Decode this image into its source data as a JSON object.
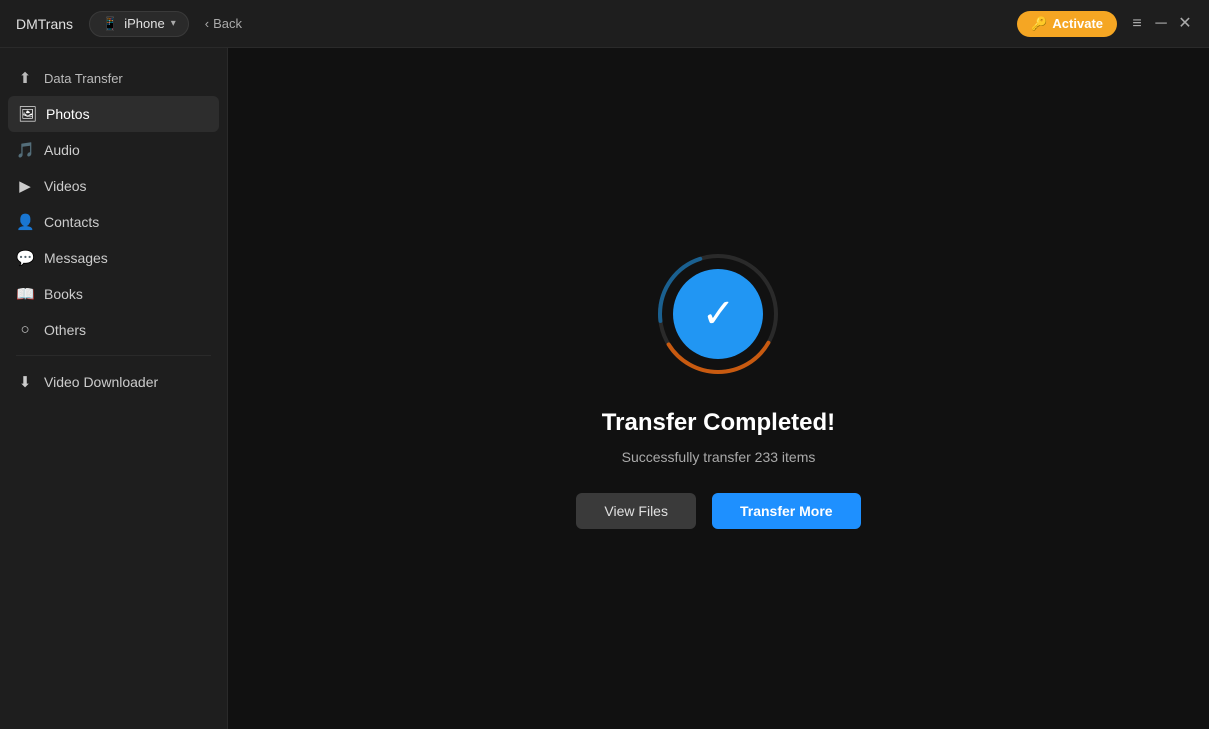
{
  "app": {
    "title": "DMTrans"
  },
  "titlebar": {
    "device_label": "iPhone",
    "back_label": "Back",
    "activate_label": "Activate",
    "menu_icon": "≡",
    "minimize_icon": "─",
    "close_icon": "✕"
  },
  "sidebar": {
    "data_transfer_label": "Data Transfer",
    "items": [
      {
        "id": "photos",
        "label": "Photos",
        "icon": "🖼"
      },
      {
        "id": "audio",
        "label": "Audio",
        "icon": "🎵"
      },
      {
        "id": "videos",
        "label": "Videos",
        "icon": "▶"
      },
      {
        "id": "contacts",
        "label": "Contacts",
        "icon": "👤"
      },
      {
        "id": "messages",
        "label": "Messages",
        "icon": "💬"
      },
      {
        "id": "books",
        "label": "Books",
        "icon": "📖"
      },
      {
        "id": "others",
        "label": "Others",
        "icon": "○"
      }
    ],
    "video_downloader_label": "Video Downloader"
  },
  "content": {
    "title": "Transfer Completed!",
    "subtitle": "Successfully transfer 233 items",
    "view_files_label": "View Files",
    "transfer_more_label": "Transfer More"
  },
  "colors": {
    "accent_blue": "#2196f3",
    "accent_orange": "#f5a623",
    "arc_orange": "#e07030",
    "arc_blue": "#1a6090"
  }
}
